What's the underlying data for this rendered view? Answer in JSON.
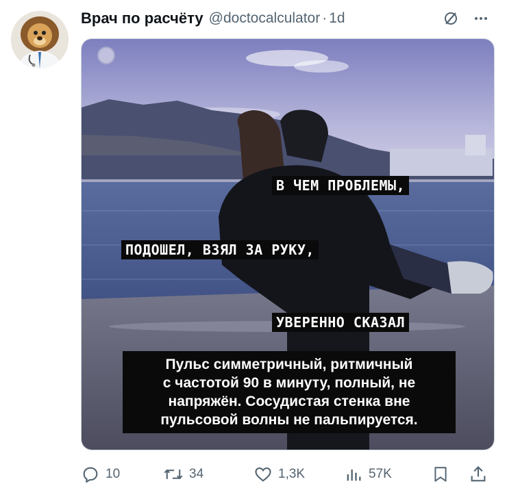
{
  "tweet": {
    "author_name": "Врач по расчёту",
    "handle": "@doctocalculator",
    "separator": "·",
    "time": "1d",
    "header_icons": [
      "grok-icon",
      "more-icon"
    ]
  },
  "meme": {
    "caption_1": "В ЧЕМ ПРОБЛЕМЫ,",
    "caption_2": "ПОДОШЕЛ, ВЗЯЛ ЗА РУКУ,",
    "caption_3": "УВЕРЕННО СКАЗАЛ",
    "quote_lines": [
      "Пульс симметричный, ритмичный",
      "с частотой 90 в минуту, полный, не",
      "напряжён. Сосудистая стенка вне",
      "пульсовой волны не пальпируется."
    ]
  },
  "actions": {
    "replies": "10",
    "reposts": "34",
    "likes": "1,3K",
    "views": "57K",
    "icons": [
      "reply-icon",
      "repost-icon",
      "like-icon",
      "views-icon",
      "bookmark-icon",
      "share-icon"
    ]
  },
  "colors": {
    "text": "#0f1419",
    "secondary": "#536471",
    "caption_bg": "#0a0a0a"
  }
}
